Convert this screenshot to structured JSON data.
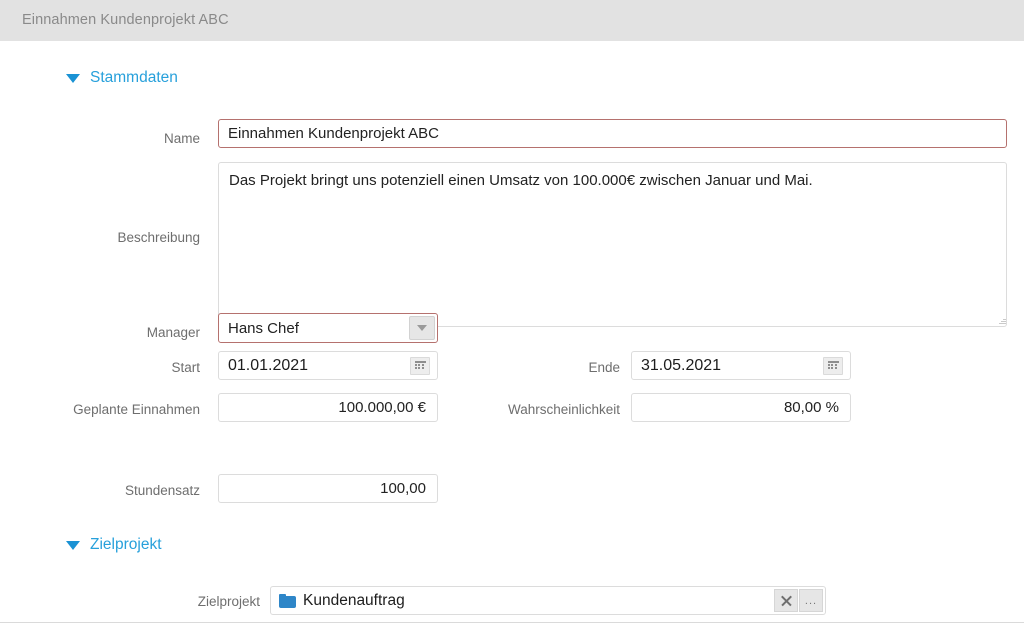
{
  "window": {
    "title": "Einnahmen Kundenprojekt ABC"
  },
  "sections": [
    {
      "id": "stammdaten",
      "title": "Stammdaten",
      "collapse_icon": "triangle-down-icon",
      "expanded": true
    },
    {
      "id": "zielprojekt",
      "title": "Zielprojekt",
      "collapse_icon": "triangle-down-icon",
      "expanded": true
    }
  ],
  "fields": {
    "name": {
      "label": "Name",
      "value": "Einnahmen Kundenprojekt ABC",
      "placeholder": "",
      "required": true
    },
    "beschreibung": {
      "label": "Beschreibung",
      "value": "Das Projekt bringt uns potenziell einen Umsatz von 100.000€ zwischen Januar und Mai.",
      "placeholder": "",
      "required": false
    },
    "manager": {
      "label": "Manager",
      "value": "Hans Chef",
      "dropdown_icon": "chevron-down-icon",
      "required": true
    },
    "start": {
      "label": "Start",
      "value": "01.01.2021",
      "calendar_icon": "calendar-icon",
      "required": false
    },
    "ende": {
      "label": "Ende",
      "value": "31.05.2021",
      "calendar_icon": "calendar-icon",
      "required": false
    },
    "geplante_einnahmen": {
      "label": "Geplante Einnahmen",
      "value": "100.000,00 €",
      "required": false
    },
    "wahrscheinlichkeit": {
      "label": "Wahrscheinlichkeit",
      "value": "80,00 %",
      "required": false
    },
    "stundensatz": {
      "label": "Stundensatz",
      "value": "100,00",
      "required": false
    },
    "zielprojekt": {
      "label": "Zielprojekt",
      "value": "Kundenauftrag",
      "folder_icon": "folder-icon",
      "clear_button": "×",
      "browse_button": "...",
      "required": false
    }
  },
  "colors": {
    "titlebar_bg": "#e2e2e2",
    "titlebar_text": "#8a8a8a",
    "section_accent": "#27a0db",
    "required_border": "#b5716e",
    "normal_border": "#dcdcdc",
    "folder_blue": "#2e86c8",
    "label_text": "#6e6e6e"
  }
}
